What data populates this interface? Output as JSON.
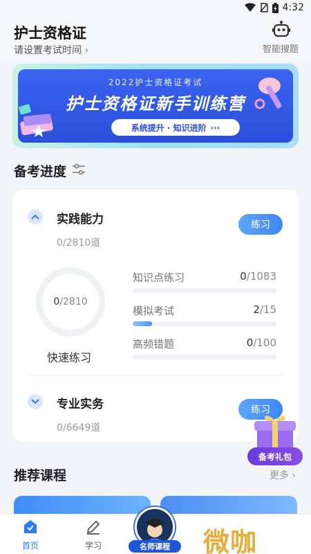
{
  "status_bar": {
    "time": "4:32",
    "icons": [
      "wifi-icon",
      "no-sim-icon",
      "battery-icon"
    ]
  },
  "header": {
    "title": "护士资格证",
    "exam_time_link": "请设置考试时间",
    "smart_search_label": "智能搜题",
    "smart_search_icon": "robot-icon"
  },
  "banner": {
    "subtitle": "2022护士资格证考试",
    "title": "护士资格证新手训练营",
    "pill_text": "系统提升 · 知识进阶",
    "pill_icon": "triple-chevron-icon"
  },
  "progress_section": {
    "title": "备考进度",
    "filter_icon": "sliders-icon"
  },
  "subjects": [
    {
      "name": "实践能力",
      "count": "0/2810道",
      "practice_label": "练习",
      "ring": {
        "done": "0",
        "total": "/2810",
        "progress": 0
      },
      "quick_practice": "快速练习",
      "stats": [
        {
          "label": "知识点练习",
          "done": "0",
          "total": "/1083",
          "progress": 0
        },
        {
          "label": "模拟考试",
          "done": "2",
          "total": "/15",
          "progress": 0.133
        },
        {
          "label": "高频错题",
          "done": "0",
          "total": "/100",
          "progress": 0
        }
      ]
    },
    {
      "name": "专业实务",
      "count": "0/6649道",
      "practice_label": "练习"
    }
  ],
  "gift": {
    "label": "备考礼包"
  },
  "recommend": {
    "title": "推荐课程",
    "more": "更多"
  },
  "tabbar": {
    "home": "首页",
    "study": "学习",
    "center": "名师课程"
  },
  "watermark": "微咖",
  "colors": {
    "accent": "#3f86f2",
    "banner_blue": "#2b4fd9",
    "gift_purple": "#7a45e0",
    "watermark": "#e5ad3c"
  }
}
